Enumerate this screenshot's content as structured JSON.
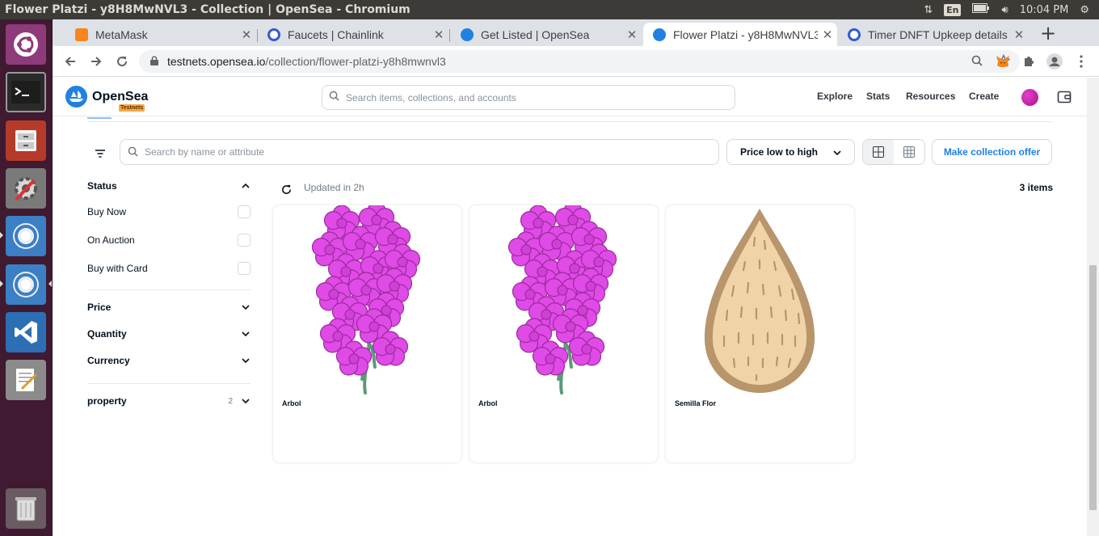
{
  "os_panel": {
    "window_title": "Flower Platzi - y8H8MwNVL3 - Collection | OpenSea - Chromium",
    "language": "En",
    "clock": "10:04 PM"
  },
  "browser": {
    "tabs": [
      {
        "title": "MetaMask",
        "favicon": "metamask-fox-icon",
        "active": false
      },
      {
        "title": "Faucets | Chainlink",
        "favicon": "chainlink-icon",
        "active": false
      },
      {
        "title": "Get Listed | OpenSea",
        "favicon": "opensea-icon",
        "active": false
      },
      {
        "title": "Flower Platzi - y8H8MwNVL3",
        "favicon": "opensea-icon",
        "active": true
      },
      {
        "title": "Timer DNFT Upkeep details",
        "favicon": "chainlink-icon",
        "active": false
      }
    ],
    "url_host": "testnets.opensea.io",
    "url_path": "/collection/flower-platzi-y8h8mwnvl3"
  },
  "opensea": {
    "brand": "OpenSea",
    "badge": "Testnets",
    "search_placeholder": "Search items, collections, and accounts",
    "nav": [
      "Explore",
      "Stats",
      "Resources",
      "Create"
    ]
  },
  "toolbar": {
    "search_placeholder": "Search by name or attribute",
    "sort_label": "Price low to high",
    "offer_label": "Make collection offer"
  },
  "filters": {
    "status_title": "Status",
    "status_options": [
      "Buy Now",
      "On Auction",
      "Buy with Card"
    ],
    "price_title": "Price",
    "quantity_title": "Quantity",
    "currency_title": "Currency",
    "property_title": "property",
    "property_count": "2"
  },
  "results": {
    "updated": "Updated in 2h",
    "count": "3 items",
    "items": [
      {
        "name": "Arbol",
        "art": "pink-flower-tree"
      },
      {
        "name": "Arbol",
        "art": "pink-flower-tree"
      },
      {
        "name": "Semilla Flor",
        "art": "seed"
      }
    ]
  },
  "colors": {
    "accent": "#2081e2",
    "flower_pink": "#e04ae6",
    "stem_green": "#5a9a78",
    "seed_fill": "#f0d4a8",
    "seed_outline": "#b8956a"
  }
}
